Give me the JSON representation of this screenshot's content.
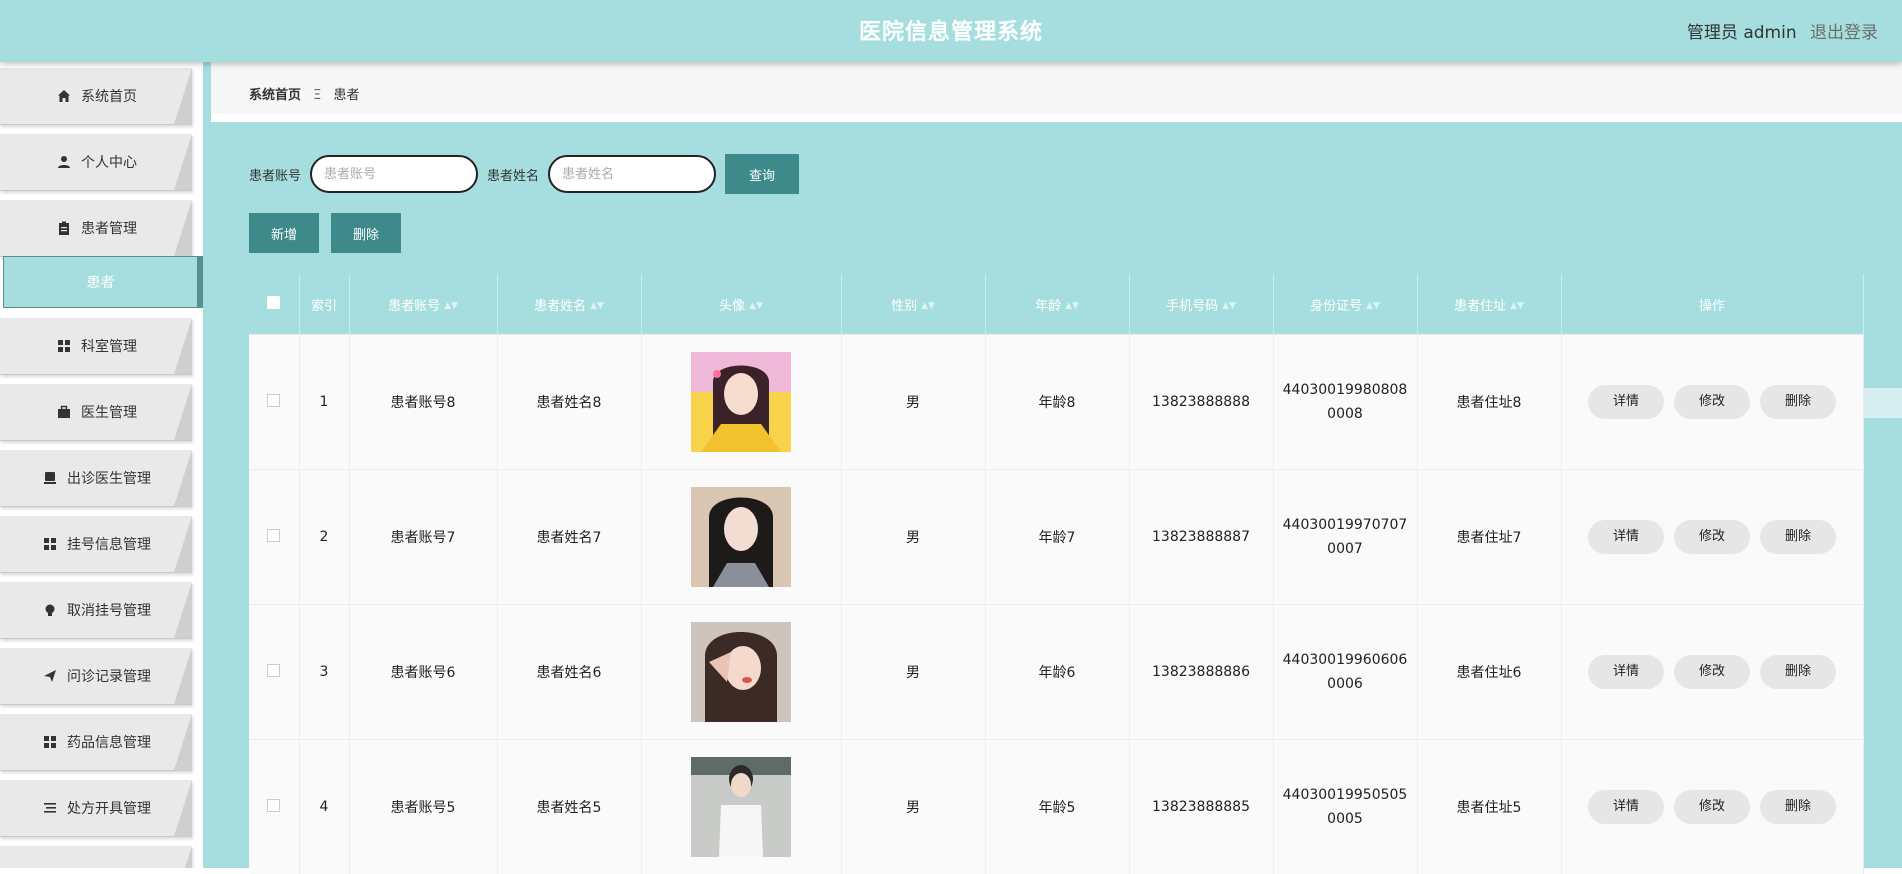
{
  "header": {
    "title": "医院信息管理系统",
    "role_text": "管理员 admin",
    "logout_label": "退出登录"
  },
  "sidebar": {
    "items": [
      {
        "label": "系统首页",
        "icon": "home-icon"
      },
      {
        "label": "个人中心",
        "icon": "person-icon"
      },
      {
        "label": "患者管理",
        "icon": "clipboard-icon"
      },
      {
        "label": "科室管理",
        "icon": "grid-icon"
      },
      {
        "label": "医生管理",
        "icon": "briefcase-icon"
      },
      {
        "label": "出诊医生管理",
        "icon": "monitor-icon"
      },
      {
        "label": "挂号信息管理",
        "icon": "grid-icon"
      },
      {
        "label": "取消挂号管理",
        "icon": "bulb-icon"
      },
      {
        "label": "问诊记录管理",
        "icon": "send-icon"
      },
      {
        "label": "药品信息管理",
        "icon": "grid-icon"
      },
      {
        "label": "处方开具管理",
        "icon": "list-icon"
      }
    ],
    "active_sub": "患者"
  },
  "breadcrumb": {
    "home": "系统首页",
    "separator": "Ξ",
    "current": "患者"
  },
  "search": {
    "account_label": "患者账号",
    "account_placeholder": "患者账号",
    "name_label": "患者姓名",
    "name_placeholder": "患者姓名",
    "query_label": "查询"
  },
  "actions": {
    "add_label": "新增",
    "delete_label": "删除"
  },
  "table": {
    "columns": [
      "索引",
      "患者账号",
      "患者姓名",
      "头像",
      "性别",
      "年龄",
      "手机号码",
      "身份证号",
      "患者住址",
      "操作"
    ],
    "rows": [
      {
        "index": "1",
        "account": "患者账号8",
        "name": "患者姓名8",
        "gender": "男",
        "age": "年龄8",
        "phone": "13823888888",
        "id_line1": "44030019980808",
        "id_line2": "0008",
        "address": "患者住址8"
      },
      {
        "index": "2",
        "account": "患者账号7",
        "name": "患者姓名7",
        "gender": "男",
        "age": "年龄7",
        "phone": "13823888887",
        "id_line1": "44030019970707",
        "id_line2": "0007",
        "address": "患者住址7"
      },
      {
        "index": "3",
        "account": "患者账号6",
        "name": "患者姓名6",
        "gender": "男",
        "age": "年龄6",
        "phone": "13823888886",
        "id_line1": "44030019960606",
        "id_line2": "0006",
        "address": "患者住址6"
      },
      {
        "index": "4",
        "account": "患者账号5",
        "name": "患者姓名5",
        "gender": "男",
        "age": "年龄5",
        "phone": "13823888885",
        "id_line1": "44030019950505",
        "id_line2": "0005",
        "address": "患者住址5"
      }
    ],
    "op_labels": {
      "detail": "详情",
      "edit": "修改",
      "delete": "删除"
    }
  },
  "colors": {
    "accent": "#a6dedf",
    "button": "#3e8a8b",
    "active_border": "#5a8f90"
  }
}
